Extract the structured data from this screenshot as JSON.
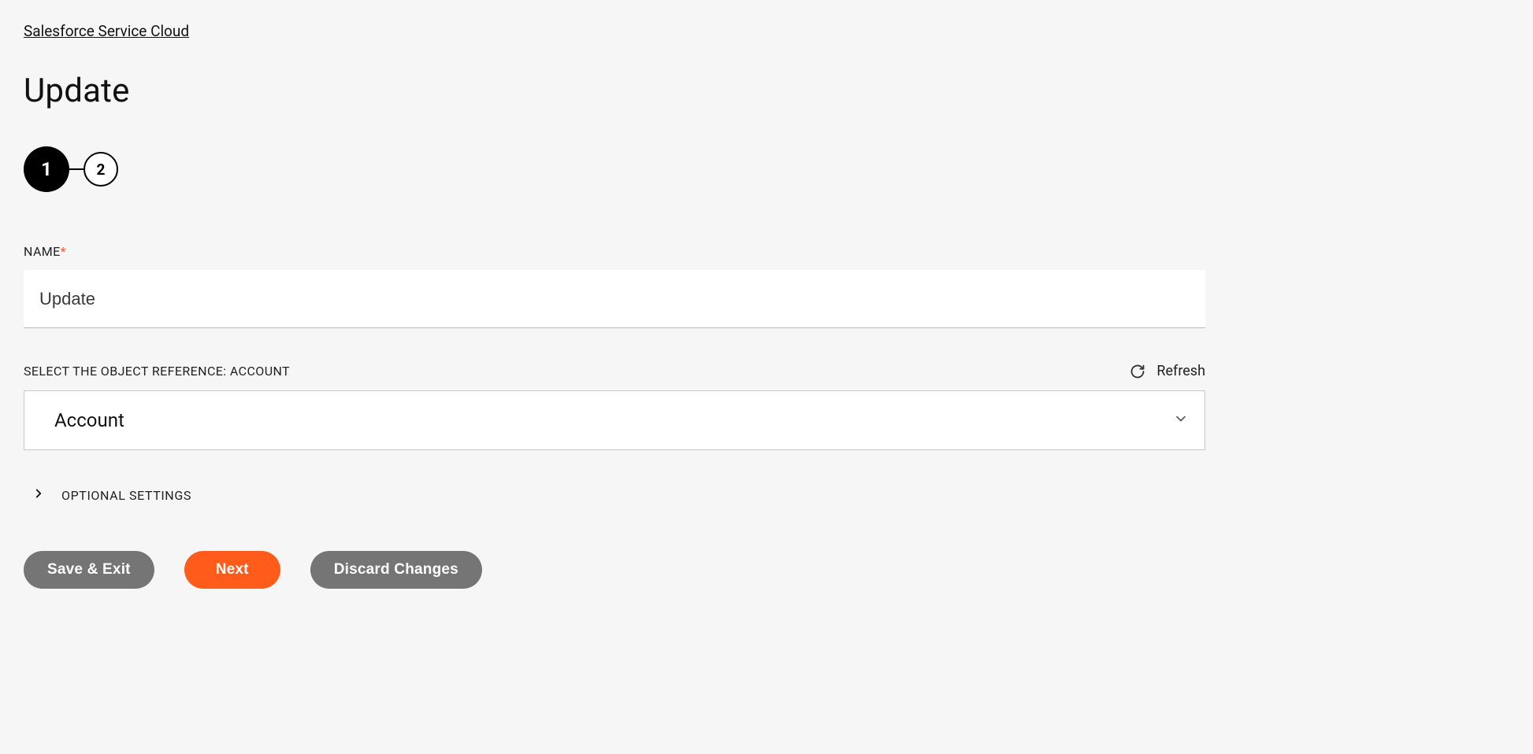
{
  "breadcrumb": {
    "label": "Salesforce Service Cloud"
  },
  "page": {
    "title": "Update"
  },
  "stepper": {
    "steps": [
      "1",
      "2"
    ],
    "active_index": 0
  },
  "fields": {
    "name": {
      "label": "NAME",
      "required_marker": "*",
      "value": "Update"
    },
    "object_ref": {
      "label": "SELECT THE OBJECT REFERENCE: ACCOUNT",
      "selected": "Account",
      "refresh_label": "Refresh"
    }
  },
  "optional": {
    "label": "OPTIONAL SETTINGS"
  },
  "buttons": {
    "save_exit": "Save & Exit",
    "next": "Next",
    "discard": "Discard Changes"
  }
}
